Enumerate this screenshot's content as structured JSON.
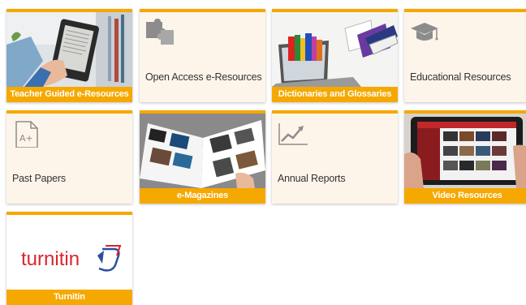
{
  "colors": {
    "accent": "#f5a800",
    "tile_bg": "#fdf5ea",
    "text": "#333333"
  },
  "tiles": [
    {
      "label": "Teacher Guided e-Resources",
      "style": "image",
      "icon": "tablet-reading-photo"
    },
    {
      "label": "Open Access e-Resources",
      "style": "plain",
      "icon": "puzzle-icon"
    },
    {
      "label": "Dictionaries and Glossaries",
      "style": "image",
      "icon": "books-laptop-photo"
    },
    {
      "label": "Educational Resources",
      "style": "plain",
      "icon": "graduation-cap-icon"
    },
    {
      "label": "Past Papers",
      "style": "plain",
      "icon": "document-aplus-icon"
    },
    {
      "label": "e-Magazines",
      "style": "image",
      "icon": "magazine-photo"
    },
    {
      "label": "Annual Reports",
      "style": "plain",
      "icon": "trend-chart-icon"
    },
    {
      "label": "Video Resources",
      "style": "image",
      "icon": "tablet-video-photo"
    },
    {
      "label": "Turnitin",
      "style": "image",
      "icon": "turnitin-logo",
      "logo_text": "turnitin"
    }
  ]
}
